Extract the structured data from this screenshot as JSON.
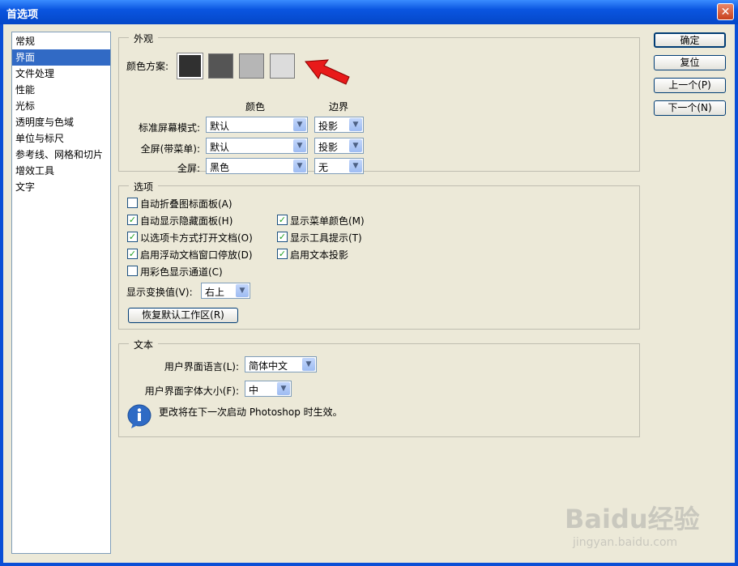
{
  "window": {
    "title": "首选项",
    "close_label": "✕"
  },
  "sidebar": {
    "items": [
      {
        "label": "常规"
      },
      {
        "label": "界面",
        "selected": true
      },
      {
        "label": "文件处理"
      },
      {
        "label": "性能"
      },
      {
        "label": "光标"
      },
      {
        "label": "透明度与色域"
      },
      {
        "label": "单位与标尺"
      },
      {
        "label": "参考线、网格和切片"
      },
      {
        "label": "增效工具"
      },
      {
        "label": "文字"
      }
    ]
  },
  "buttons": {
    "ok": "确定",
    "reset": "复位",
    "prev": "上一个(P)",
    "next": "下一个(N)"
  },
  "appearance": {
    "title": "外观",
    "color_scheme_label": "颜色方案:",
    "swatches": [
      "#303030",
      "#555555",
      "#b6b6b6",
      "#dcdcdc"
    ],
    "col_color": "颜色",
    "col_border": "边界",
    "rows": [
      {
        "label": "标准屏幕模式:",
        "color": "默认",
        "border": "投影"
      },
      {
        "label": "全屏(带菜单):",
        "color": "默认",
        "border": "投影"
      },
      {
        "label": "全屏:",
        "color": "黑色",
        "border": "无"
      }
    ]
  },
  "options": {
    "title": "选项",
    "left": [
      {
        "label": "自动折叠图标面板(A)",
        "checked": false
      },
      {
        "label": "自动显示隐藏面板(H)",
        "checked": true
      },
      {
        "label": "以选项卡方式打开文档(O)",
        "checked": true
      },
      {
        "label": "启用浮动文档窗口停放(D)",
        "checked": true
      },
      {
        "label": "用彩色显示通道(C)",
        "checked": false
      }
    ],
    "right": [
      {
        "label": "显示菜单颜色(M)",
        "checked": true
      },
      {
        "label": "显示工具提示(T)",
        "checked": true
      },
      {
        "label": "启用文本投影",
        "checked": true
      }
    ],
    "transform_label": "显示变换值(V):",
    "transform_value": "右上",
    "restore_button": "恢复默认工作区(R)"
  },
  "text": {
    "title": "文本",
    "language_label": "用户界面语言(L):",
    "language_value": "简体中文",
    "font_size_label": "用户界面字体大小(F):",
    "font_size_value": "中",
    "info": "更改将在下一次启动 Photoshop 时生效。"
  },
  "watermark": {
    "brand": "Baidu经验",
    "url": "jingyan.baidu.com"
  },
  "colors": {
    "selection": "#316ac5",
    "title_bar": "#0a55e0",
    "arrow": "#e81a1a"
  }
}
